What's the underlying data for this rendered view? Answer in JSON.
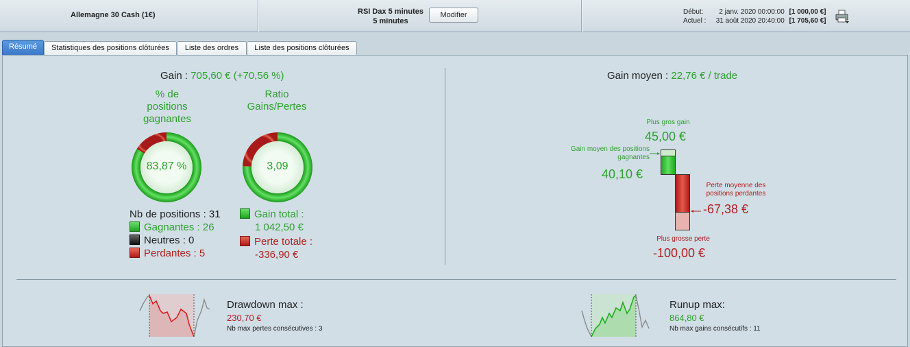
{
  "header": {
    "instrument": "Allemagne 30 Cash (1€)",
    "strategy_line1": "RSI Dax 5 minutes",
    "strategy_line2": "5 minutes",
    "modify_button": "Modifier",
    "start_label": "Début:",
    "start_date": "2 janv. 2020 00:00:00",
    "start_capital": "[1 000,00 €]",
    "current_label": "Actuel :",
    "current_date": "31 août 2020 20:40:00",
    "current_capital": "[1 705,60 €]",
    "print_icon": "printer-icon"
  },
  "tabs": [
    {
      "label": "Résumé",
      "active": true
    },
    {
      "label": "Statistiques des positions clôturées",
      "active": false
    },
    {
      "label": "Liste des ordres",
      "active": false
    },
    {
      "label": "Liste des positions clôturées",
      "active": false
    }
  ],
  "summary": {
    "gain_label": "Gain : ",
    "gain_value": "705,60 € (+70,56 %)",
    "win_pct_title_1": "% de",
    "win_pct_title_2": "positions",
    "win_pct_title_3": "gagnantes",
    "win_pct_value": "83,87 %",
    "win_pct_fraction": 0.8387,
    "ratio_title_1": "Ratio",
    "ratio_title_2": "Gains/Pertes",
    "ratio_value": "3,09",
    "ratio_green_fraction": 0.7556,
    "nb_positions": "Nb de positions : 31",
    "winners": "Gagnantes : 26",
    "neutral": "Neutres : 0",
    "losers": "Perdantes : 5",
    "total_gain_label": "Gain total :",
    "total_gain_value": "1 042,50 €",
    "total_loss_label": "Perte totale :",
    "total_loss_value": "-336,90 €",
    "avg_gain_label": "Gain moyen : ",
    "avg_gain_value": "22,76 € / trade",
    "biggest_gain_label": "Plus gros gain",
    "biggest_gain_value": "45,00 €",
    "avg_win_label_1": "Gain moyen des positions",
    "avg_win_label_2": "gagnantes",
    "avg_win_value": "40,10 €",
    "avg_loss_label_1": "Perte moyenne des",
    "avg_loss_label_2": "positions perdantes",
    "avg_loss_value": "-67,38 €",
    "biggest_loss_label": "Plus grosse perte",
    "biggest_loss_value": "-100,00 €",
    "drawdown_title": "Drawdown max :",
    "drawdown_value": "230,70 €",
    "drawdown_sub": "Nb max pertes consécutives : 3",
    "runup_title": "Runup max:",
    "runup_value": "864,80 €",
    "runup_sub": "Nb max gains consécutifs : 11"
  },
  "colors": {
    "green": "#2ea12e",
    "red": "#b41e1e",
    "accent_tab": "#3b78c9"
  }
}
